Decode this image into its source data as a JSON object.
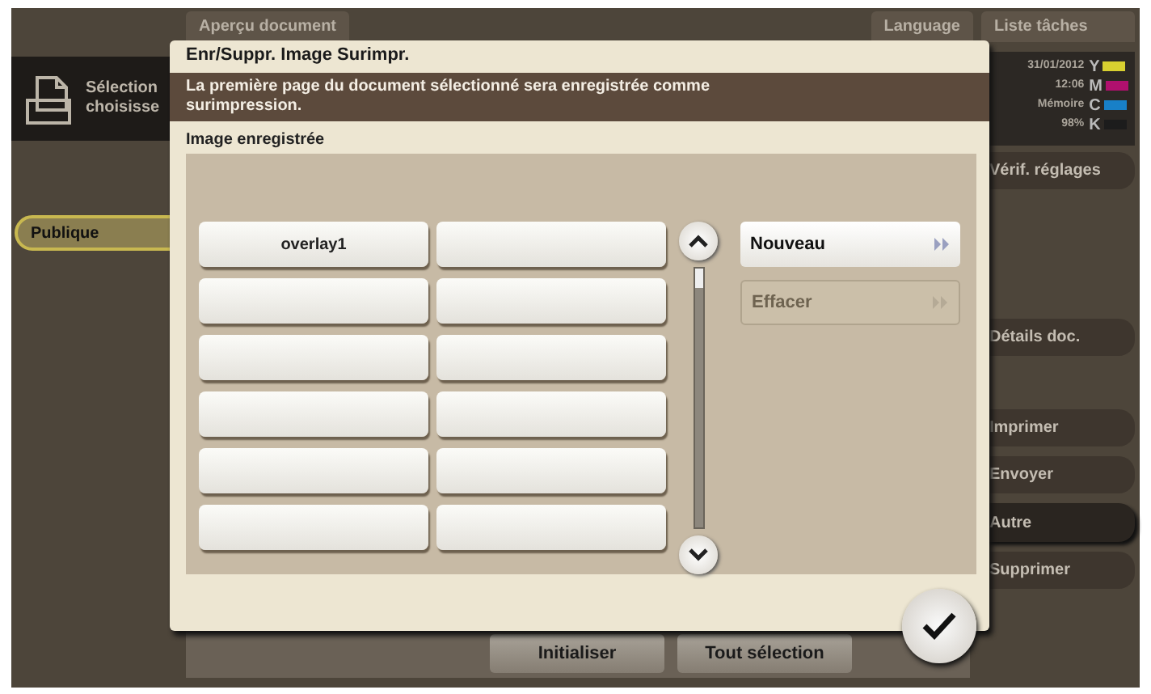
{
  "header_tabs": {
    "left": "Aperçu document",
    "language": "Language",
    "jobs": "Liste tâches"
  },
  "left_panel": {
    "header_lines": [
      "Sélection",
      "choisisse"
    ],
    "tabs": [
      {
        "label": "Publique",
        "selected": true
      }
    ]
  },
  "status": {
    "date": "31/01/2012",
    "time": "12:06",
    "memory_label": "Mémoire",
    "memory": "98%",
    "toners": [
      {
        "label": "Y",
        "color": "#d8d030"
      },
      {
        "label": "M",
        "color": "#b0106e"
      },
      {
        "label": "C",
        "color": "#1880c8"
      },
      {
        "label": "K",
        "color": "#1c1c1c"
      }
    ]
  },
  "right_buttons": [
    {
      "label": "Vérif. réglages",
      "selected": false
    },
    {
      "label": "Détails doc.",
      "selected": false
    },
    {
      "label": "Imprimer",
      "selected": false
    },
    {
      "label": "Envoyer",
      "selected": false
    },
    {
      "label": "Autre",
      "selected": true
    },
    {
      "label": "Supprimer",
      "selected": false
    }
  ],
  "bottom_buttons": [
    "Initialiser",
    "Tout sélection"
  ],
  "dialog": {
    "title": "Enr/Suppr. Image Surimpr.",
    "message": "La première page du document sélectionné sera enregistrée comme surimpression.",
    "section_label": "Image enregistrée",
    "slots": [
      {
        "label": "overlay1"
      }
    ],
    "actions": [
      {
        "label": "Nouveau",
        "disabled": false
      },
      {
        "label": "Effacer",
        "disabled": true
      }
    ]
  }
}
